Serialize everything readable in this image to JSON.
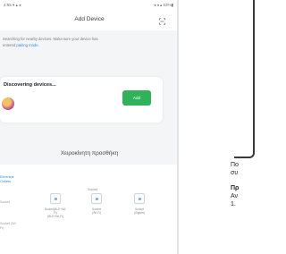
{
  "status_bar": {
    "left": "4:55 ▾ ▴ ◂",
    "right": "◂ ◂ ▴ 53%▮"
  },
  "app_bar": {
    "title": "Add Device"
  },
  "intro": {
    "text": "Searching for nearby devices. Make sure your device has",
    "text2": "entered",
    "link": "pairing mode."
  },
  "discover_card": {
    "heading": "Discovering devices...",
    "add_label": "Add"
  },
  "section_title": "Χειροκίνητη προσθήκη",
  "category": {
    "label_line1": "Electrical",
    "label_line2": "Outlets",
    "subhead": "Socket",
    "side_label1": "Socket",
    "side_label2a": "Socket (Wi-",
    "side_label2b": "Fi)"
  },
  "devices": [
    {
      "label1": "Socket(BLE+Wi-",
      "label2": "Fi)",
      "label3": "(BLE+Wi-Fi)"
    },
    {
      "label1": "Socket",
      "label2": "(Wi-Fi)",
      "label3": ""
    },
    {
      "label1": "Socket",
      "label2": "(Zigbee)",
      "label3": ""
    }
  ],
  "right_page": {
    "line1": "Πο",
    "line2": "συ",
    "heading": "Πρ",
    "line3": "Αν",
    "line4": "1."
  },
  "colors": {
    "accent_green": "#2fb25a",
    "link_blue": "#2c8ce0"
  }
}
